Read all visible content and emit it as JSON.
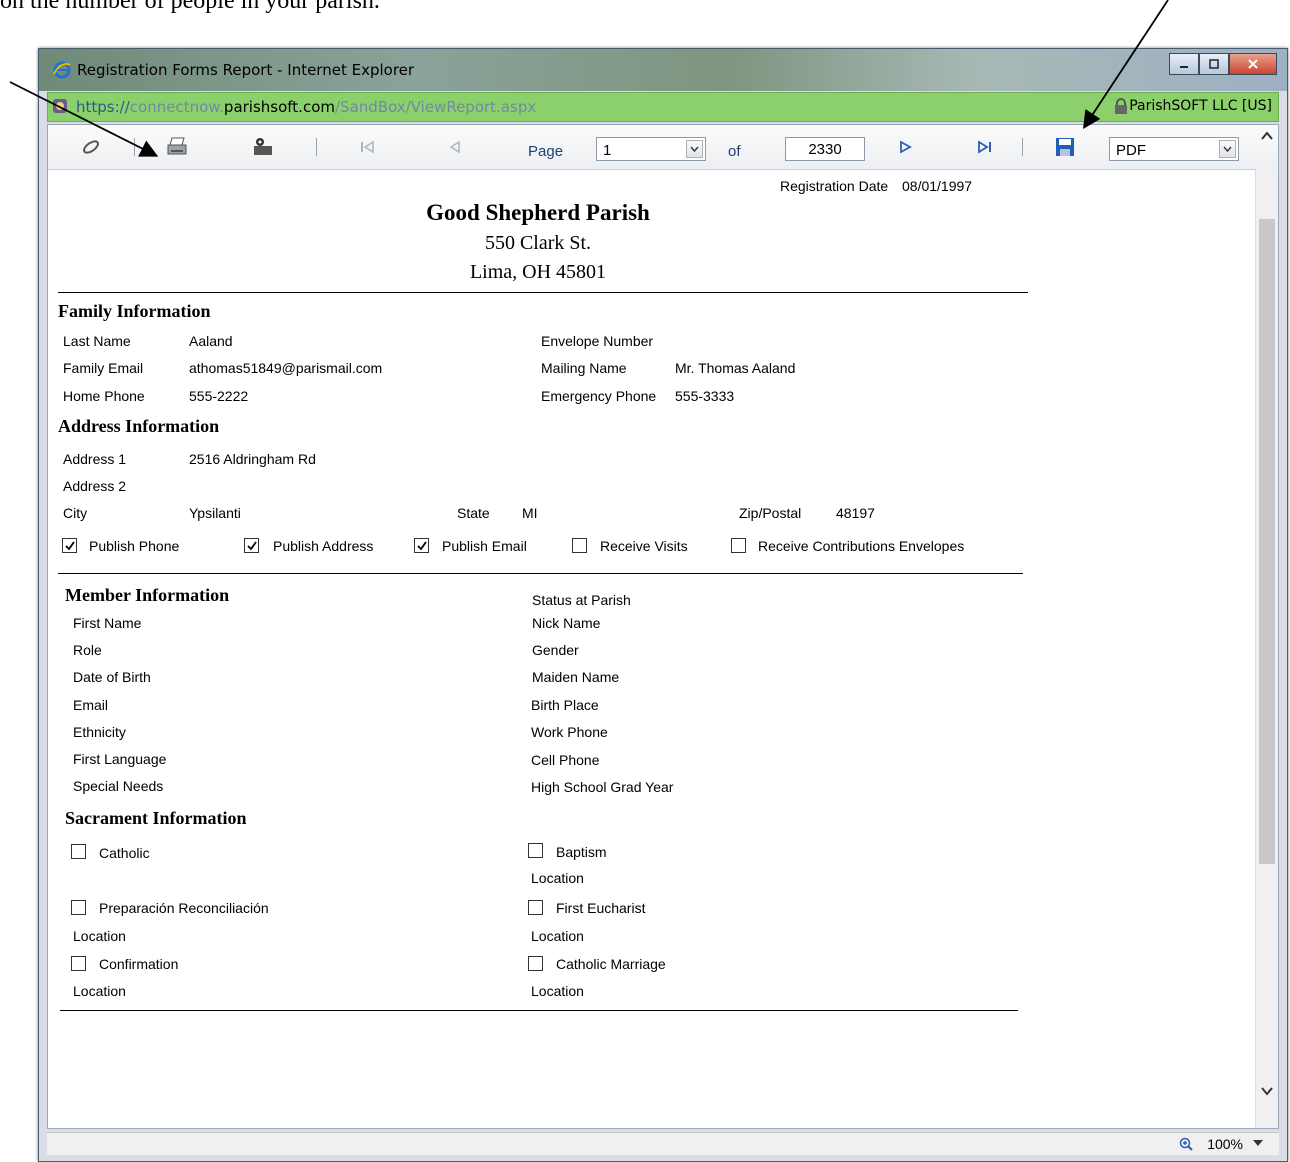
{
  "document": {
    "leading_text": "on the number of people in your parish."
  },
  "window": {
    "title": "Registration Forms Report - Internet Explorer",
    "url_scheme": "https://",
    "url_sub": "connectnow.",
    "url_host": "parishsoft.com",
    "url_path": "/SandBox/ViewReport.aspx",
    "cert_label": "ParishSOFT LLC [US]"
  },
  "toolbar": {
    "page_label": "Page",
    "page_value": "1",
    "of_label": "of",
    "total_pages": "2330",
    "export_format": "PDF"
  },
  "report": {
    "registration_date_label": "Registration Date",
    "registration_date": "08/01/1997",
    "parish_name": "Good Shepherd Parish",
    "parish_street": "550 Clark St.",
    "parish_city": "Lima, OH 45801",
    "family": {
      "heading": "Family Information",
      "last_name_label": "Last Name",
      "last_name": "Aaland",
      "email_label": "Family Email",
      "email": "athomas51849@parismail.com",
      "home_phone_label": "Home Phone",
      "home_phone": "555-2222",
      "envelope_label": "Envelope Number",
      "mailing_name_label": "Mailing Name",
      "mailing_name": "Mr. Thomas Aaland",
      "emergency_label": "Emergency Phone",
      "emergency_phone": "555-3333"
    },
    "address": {
      "heading": "Address Information",
      "address1_label": "Address 1",
      "address1": "2516 Aldringham Rd",
      "address2_label": "Address 2",
      "city_label": "City",
      "city": "Ypsilanti",
      "state_label": "State",
      "state": "MI",
      "zip_label": "Zip/Postal",
      "zip": "48197",
      "publish_phone": "Publish Phone",
      "publish_address": "Publish Address",
      "publish_email": "Publish Email",
      "receive_visits": "Receive Visits",
      "receive_envelopes": "Receive Contributions Envelopes"
    },
    "member": {
      "heading": "Member Information",
      "status_label": "Status at Parish",
      "first_name": "First Name",
      "role": "Role",
      "dob": "Date of Birth",
      "email": "Email",
      "ethnicity": "Ethnicity",
      "first_language": "First Language",
      "special_needs": "Special Needs",
      "nick_name": "Nick Name",
      "gender": "Gender",
      "maiden_name": "Maiden Name",
      "birth_place": "Birth Place",
      "work_phone": "Work Phone",
      "cell_phone": "Cell Phone",
      "grad_year": "High School Grad Year"
    },
    "sacrament": {
      "heading": "Sacrament Information",
      "catholic": "Catholic",
      "prep_reconciliation": "Preparación Reconciliación",
      "confirmation": "Confirmation",
      "baptism": "Baptism",
      "first_eucharist": "First Eucharist",
      "catholic_marriage": "Catholic Marriage",
      "location": "Location"
    }
  },
  "status": {
    "zoom": "100%"
  }
}
